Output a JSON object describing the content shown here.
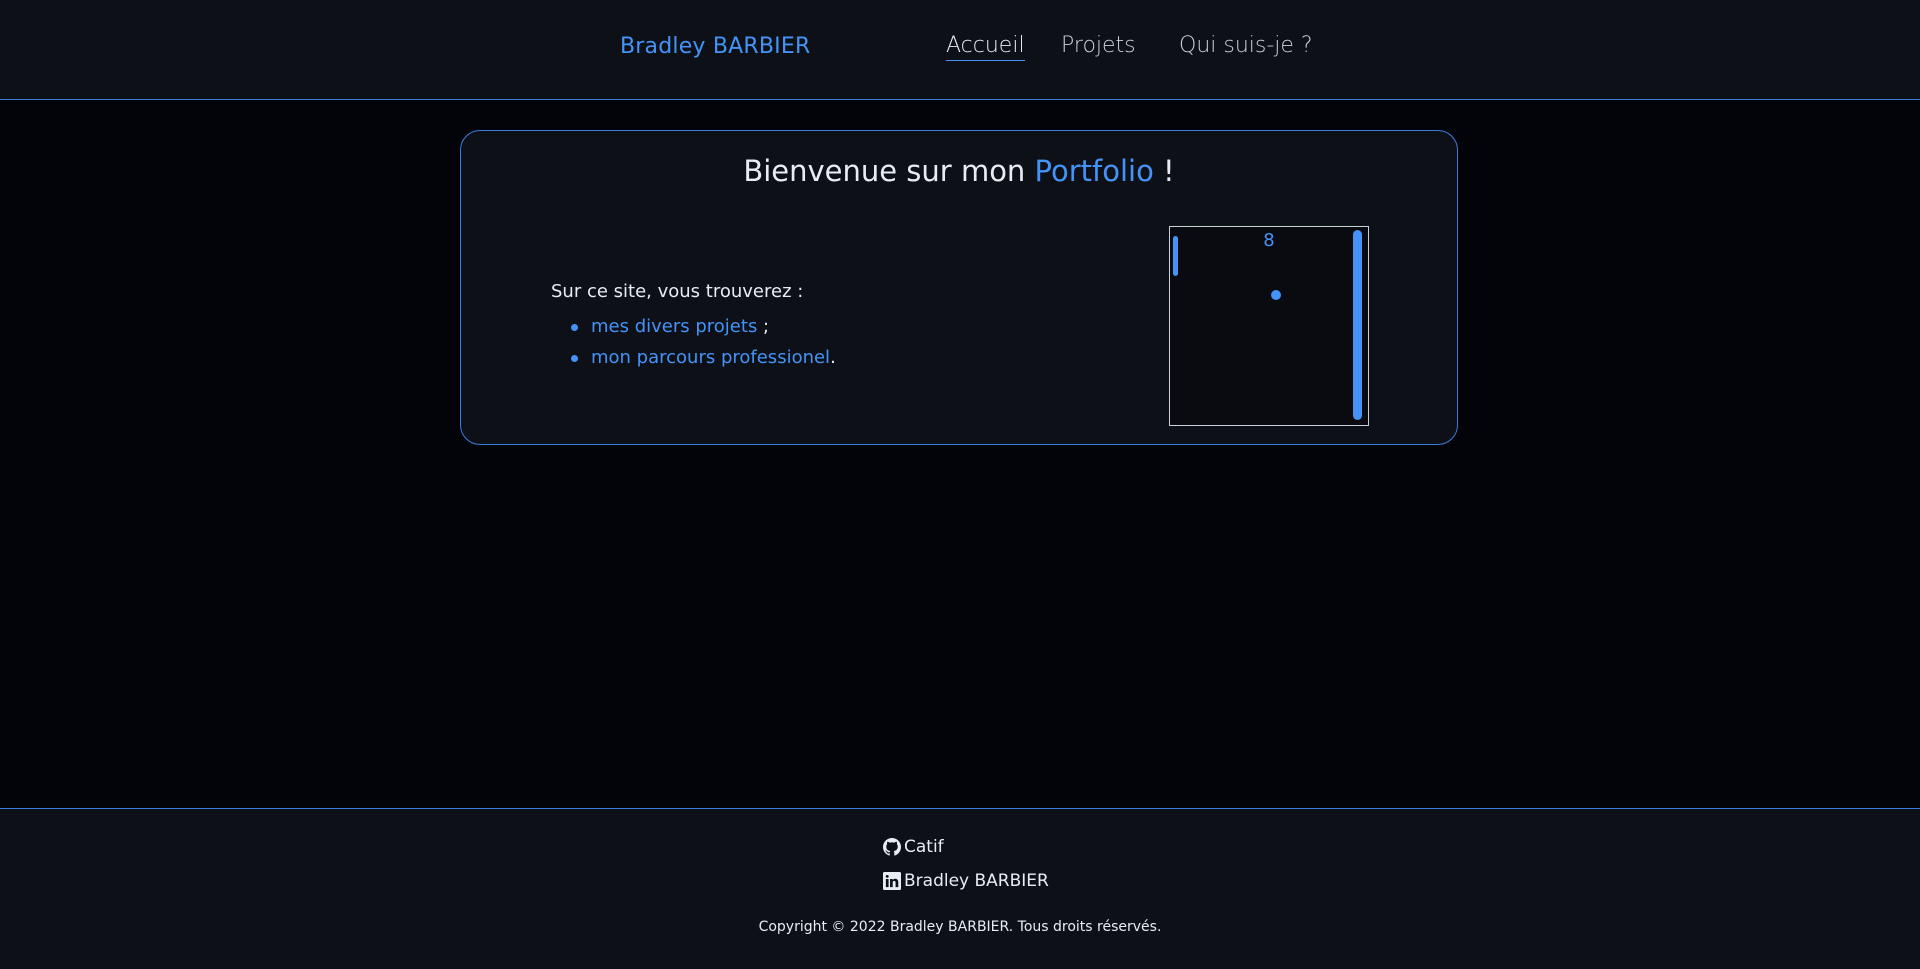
{
  "header": {
    "brand": "Bradley BARBIER",
    "nav": [
      {
        "label": "Accueil",
        "active": true
      },
      {
        "label": "Projets",
        "active": false
      },
      {
        "label": "Qui suis-je ?",
        "active": false
      }
    ]
  },
  "main": {
    "title_prefix": "Bienvenue sur mon ",
    "title_accent": "Portfolio",
    "title_suffix": " !",
    "intro": "Sur ce site, vous trouverez :",
    "items": [
      {
        "link": "mes divers projets",
        "suffix": " ;"
      },
      {
        "link": "mon parcours professionel",
        "suffix": "."
      }
    ],
    "game": {
      "score": "8"
    }
  },
  "footer": {
    "github_label": "Catif",
    "linkedin_label": "Bradley BARBIER",
    "copyright": "Copyright © 2022 Bradley BARBIER. Tous droits réservés."
  },
  "colors": {
    "accent": "#4493f8",
    "background": "#020409",
    "surface": "#0d1117"
  }
}
